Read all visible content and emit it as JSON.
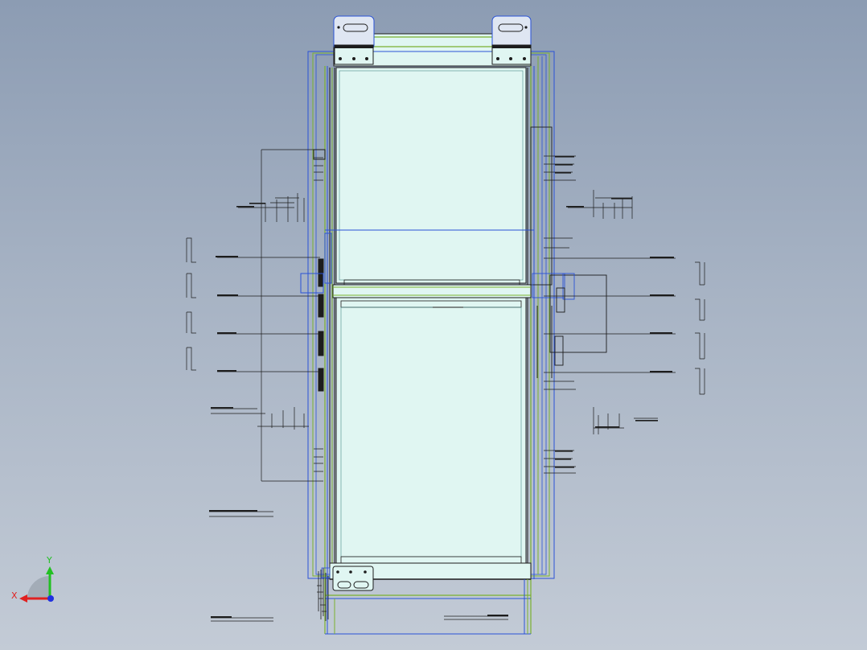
{
  "viewport": {
    "background_top": "#8c9cb3",
    "background_bottom": "#c3cbd6",
    "panel_fill": "#e0f6f2",
    "outline_blue": "#2a52d6",
    "outline_green": "#7ab12e",
    "outline_dark": "#1c1c1c"
  },
  "triad": {
    "x_label": "X",
    "y_label": "Y",
    "x_color": "#e02020",
    "y_color": "#22c022",
    "z_color": "#2030e0"
  }
}
